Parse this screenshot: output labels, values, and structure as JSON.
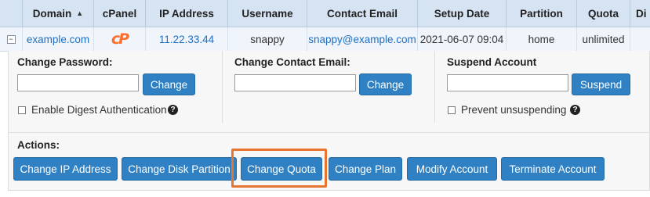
{
  "columns": {
    "domain": "Domain",
    "sort_indicator": "▲",
    "cpanel": "cPanel",
    "ip_address": "IP Address",
    "username": "Username",
    "contact_email": "Contact Email",
    "setup_date": "Setup Date",
    "partition": "Partition",
    "quota": "Quota",
    "disk": "Di"
  },
  "account": {
    "expander": "⊟",
    "domain": "example.com",
    "cpanel_logo": "cP",
    "ip_address": "11.22.33.44",
    "username": "snappy",
    "contact_email": "snappy@example.com",
    "setup_date": "2021-06-07 09:04",
    "partition": "home",
    "quota": "unlimited"
  },
  "change_password": {
    "label": "Change Password:",
    "input_value": "",
    "button": "Change",
    "digest_label": "Enable Digest Authentication",
    "digest_checked": false
  },
  "change_email": {
    "label": "Change Contact Email:",
    "input_value": "",
    "button": "Change"
  },
  "suspend": {
    "label": "Suspend Account",
    "input_value": "",
    "button": "Suspend",
    "prevent_label": "Prevent unsuspending",
    "prevent_checked": false
  },
  "actions": {
    "label": "Actions:",
    "buttons": [
      "Change IP Address",
      "Change Disk Partition",
      "Change Quota",
      "Change Plan",
      "Modify Account",
      "Terminate Account"
    ]
  },
  "icons": {
    "help": "?"
  },
  "colors": {
    "accent_button": "#2f81c3",
    "highlight_box": "#e8752f",
    "cpanel_logo": "#ff6c2c",
    "header_bg": "#d6e3f3",
    "link": "#1e6fc2"
  }
}
